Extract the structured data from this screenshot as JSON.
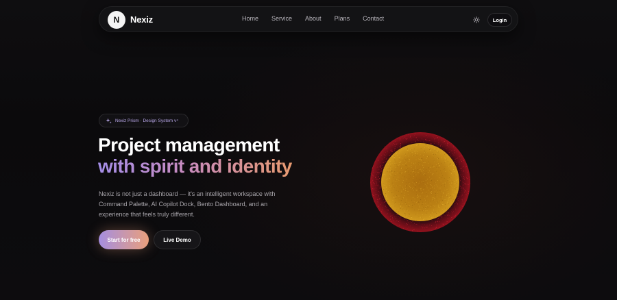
{
  "navbar": {
    "logo_letter": "N",
    "brand": "Nexiz",
    "links": [
      "Home",
      "Service",
      "About",
      "Plans",
      "Contact"
    ],
    "theme_icon": "sun-icon",
    "login_label": "Login"
  },
  "hero": {
    "badge_icon": "sparkle-icon",
    "badge_text": "Nexiz Prism · Design System v⁴",
    "headline_line1": "Project management",
    "headline_line2": "with spirit and identity",
    "description": "Nexiz is not just a dashboard — it's an intelligent workspace with Command Palette, AI Copilot Dock, Bento Dashboard, and an experience that feels truly different.",
    "primary_button": "Start for free",
    "secondary_button": "Live Demo"
  },
  "colors": {
    "background": "#0b0a0c",
    "gradient_start": "#a58ee8",
    "gradient_end": "#e89a70",
    "orb_core": "#d79a1f",
    "orb_ring": "#b8162a"
  }
}
